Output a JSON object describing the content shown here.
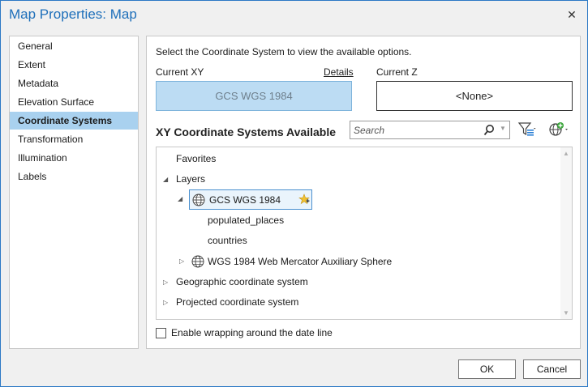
{
  "window": {
    "title": "Map Properties: Map",
    "close_glyph": "✕"
  },
  "nav": {
    "items": [
      {
        "label": "General",
        "selected": false
      },
      {
        "label": "Extent",
        "selected": false
      },
      {
        "label": "Metadata",
        "selected": false
      },
      {
        "label": "Elevation Surface",
        "selected": false
      },
      {
        "label": "Coordinate Systems",
        "selected": true
      },
      {
        "label": "Transformation",
        "selected": false
      },
      {
        "label": "Illumination",
        "selected": false
      },
      {
        "label": "Labels",
        "selected": false
      }
    ]
  },
  "panel": {
    "instructions": "Select the Coordinate System to view the available options.",
    "current_xy_label": "Current XY",
    "details_link": "Details",
    "current_z_label": "Current Z",
    "current_xy_value": "GCS WGS 1984",
    "current_z_value": "<None>",
    "available_title": "XY Coordinate Systems Available",
    "search_placeholder": "Search"
  },
  "tree": {
    "favorites": "Favorites",
    "layers": "Layers",
    "gcs_wgs": "GCS WGS 1984",
    "populated_places": "populated_places",
    "countries": "countries",
    "web_mercator": "WGS 1984 Web Mercator Auxiliary Sphere",
    "geographic": "Geographic coordinate system",
    "projected": "Projected coordinate system"
  },
  "options": {
    "wrap_date_line": "Enable wrapping around the date line",
    "wrap_checked": false
  },
  "footer": {
    "ok": "OK",
    "cancel": "Cancel"
  },
  "colors": {
    "accent": "#1e6fba",
    "selection": "#a9d1ef",
    "current_xy_bg": "#bcdcf3",
    "favorite_star": "#e8b520"
  }
}
